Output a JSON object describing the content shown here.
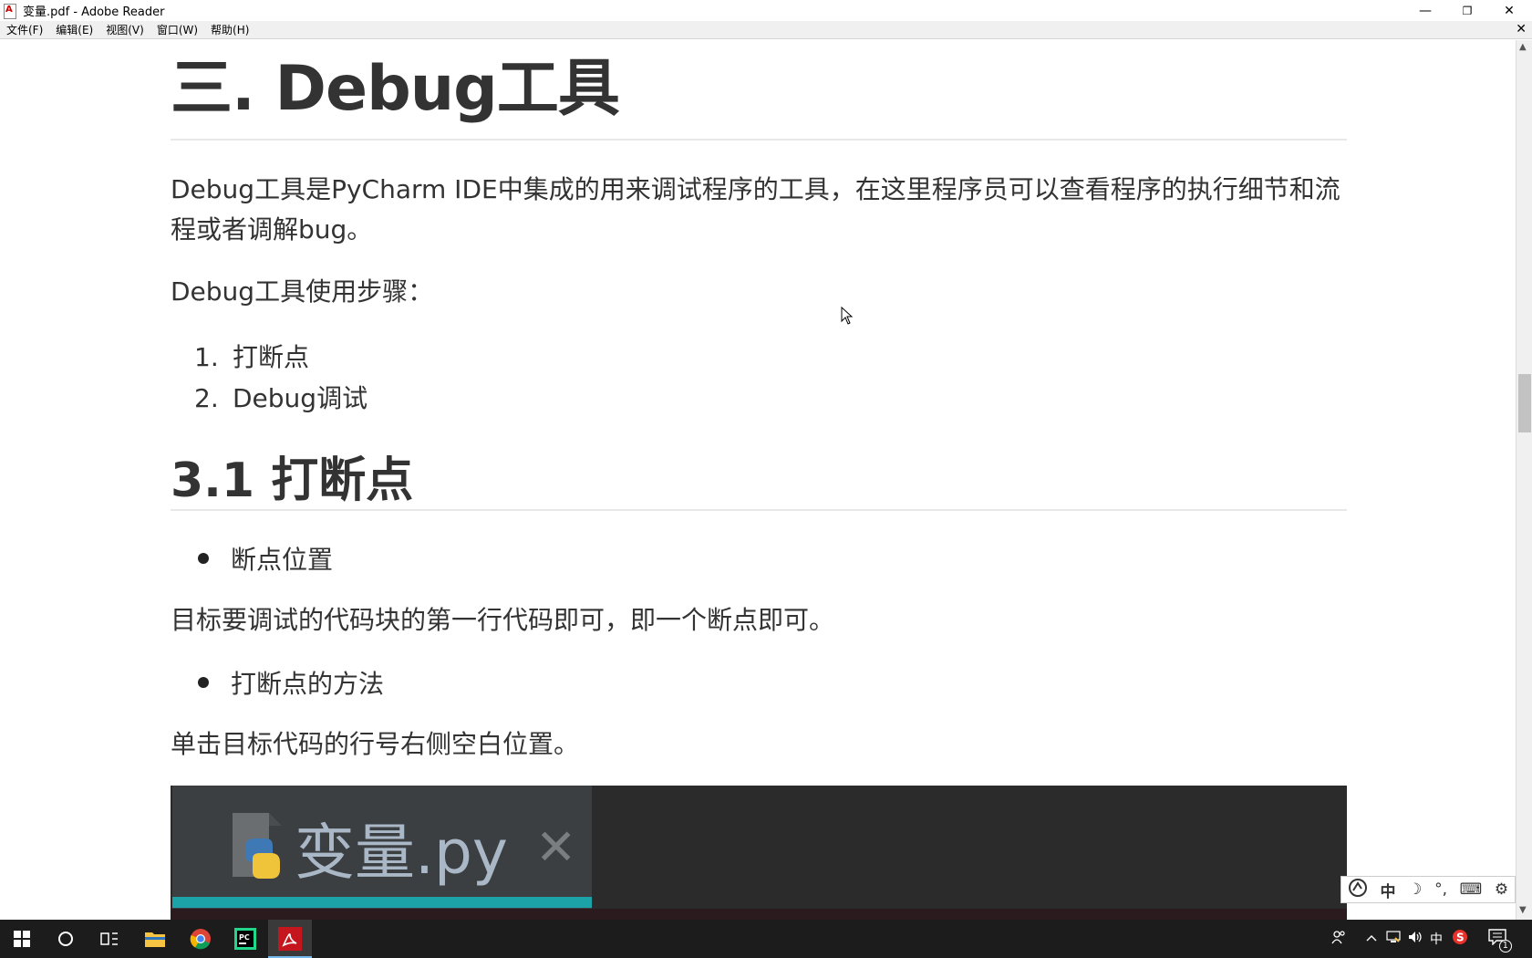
{
  "window": {
    "title": "变量.pdf - Adobe Reader",
    "minimize": "—",
    "restore": "❐",
    "close": "✕"
  },
  "menu": {
    "items": [
      "文件(F)",
      "编辑(E)",
      "视图(V)",
      "窗口(W)",
      "帮助(H)"
    ],
    "close": "✕"
  },
  "document": {
    "heading1": "三. Debug工具",
    "intro": "Debug工具是PyCharm IDE中集成的用来调试程序的工具，在这里程序员可以查看程序的执行细节和流程或者调解bug。",
    "steps_title": "Debug工具使用步骤：",
    "steps": [
      {
        "num": "1.",
        "text": "打断点"
      },
      {
        "num": "2.",
        "text": "Debug调试"
      }
    ],
    "heading2": "3.1 打断点",
    "bullet1": "断点位置",
    "para1": "目标要调试的代码块的第一行代码即可，即一个断点即可。",
    "bullet2": "打断点的方法",
    "para2": "单击目标代码的行号右侧空白位置。",
    "code_tab": "变量.py",
    "code_tab_close": "✕"
  },
  "ime": {
    "lang": "中",
    "moon": "☽",
    "punct": "°,",
    "keyboard": "⌨",
    "settings": "⚙"
  },
  "tray": {
    "lang": "中",
    "notifications": "1"
  },
  "colors": {
    "taskbar": "#1c1c1c",
    "tab_underline": "#1ba3a8",
    "code_bg": "#2b2b2b",
    "text": "#333333"
  }
}
